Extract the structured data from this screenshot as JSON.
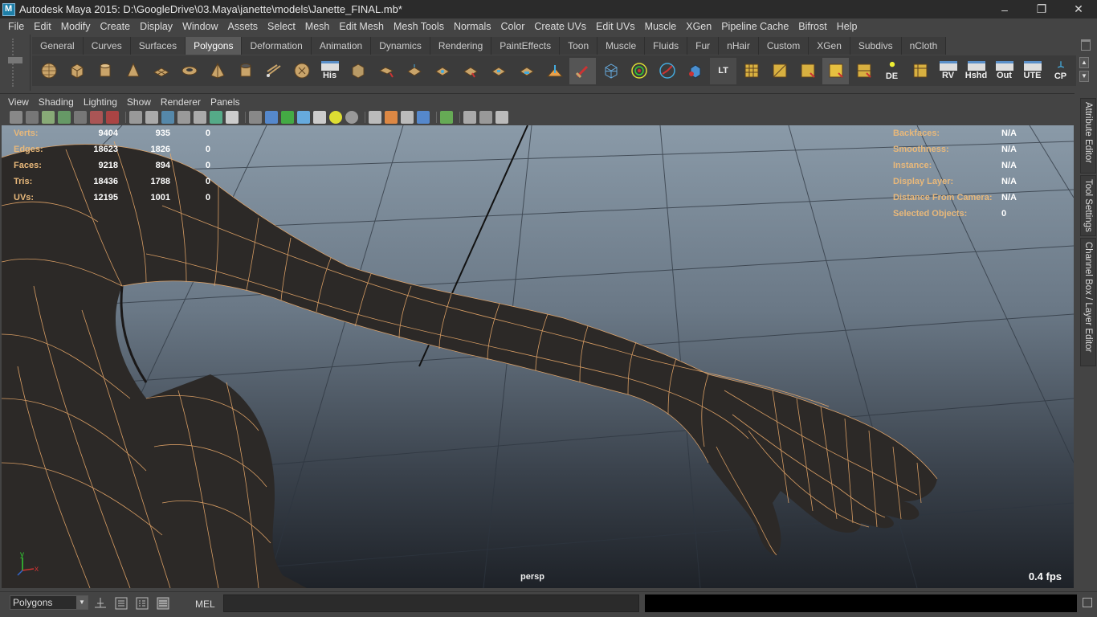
{
  "window": {
    "title": "Autodesk Maya 2015: D:\\GoogleDrive\\03.Maya\\janette\\models\\Janette_FINAL.mb*",
    "minimize": "–",
    "restore": "❐",
    "close": "✕"
  },
  "menubar": [
    "File",
    "Edit",
    "Modify",
    "Create",
    "Display",
    "Window",
    "Assets",
    "Select",
    "Mesh",
    "Edit Mesh",
    "Mesh Tools",
    "Normals",
    "Color",
    "Create UVs",
    "Edit UVs",
    "Muscle",
    "XGen",
    "Pipeline Cache",
    "Bifrost",
    "Help"
  ],
  "shelf": {
    "tabs": [
      "General",
      "Curves",
      "Surfaces",
      "Polygons",
      "Deformation",
      "Animation",
      "Dynamics",
      "Rendering",
      "PaintEffects",
      "Toon",
      "Muscle",
      "Fluids",
      "Fur",
      "nHair",
      "Custom",
      "XGen",
      "Subdivs",
      "nCloth"
    ],
    "active_tab": "Polygons",
    "icon_labels": {
      "his": "His",
      "lt": "LT",
      "de": "DE",
      "rv": "RV",
      "hshd": "Hshd",
      "out": "Out",
      "ute": "UTE",
      "cp": "CP"
    }
  },
  "panel": {
    "menus": [
      "View",
      "Shading",
      "Lighting",
      "Show",
      "Renderer",
      "Panels"
    ],
    "camera": "persp",
    "fps": "0.4 fps"
  },
  "hud": {
    "stats": [
      {
        "label": "Verts:",
        "v1": "9404",
        "v2": "935",
        "v3": "0"
      },
      {
        "label": "Edges:",
        "v1": "18623",
        "v2": "1826",
        "v3": "0"
      },
      {
        "label": "Faces:",
        "v1": "9218",
        "v2": "894",
        "v3": "0"
      },
      {
        "label": "Tris:",
        "v1": "18436",
        "v2": "1788",
        "v3": "0"
      },
      {
        "label": "UVs:",
        "v1": "12195",
        "v2": "1001",
        "v3": "0"
      }
    ],
    "info": [
      {
        "label": "Backfaces:",
        "value": "N/A"
      },
      {
        "label": "Smoothness:",
        "value": "N/A"
      },
      {
        "label": "Instance:",
        "value": "N/A"
      },
      {
        "label": "Display Layer:",
        "value": "N/A"
      },
      {
        "label": "Distance From Camera:",
        "value": "N/A"
      },
      {
        "label": "Selected Objects:",
        "value": "0"
      }
    ],
    "axis_y": "y",
    "axis_x": "x"
  },
  "side_tabs": [
    "Attribute Editor",
    "Tool Settings",
    "Channel Box / Layer Editor"
  ],
  "bottom": {
    "mode": "Polygons",
    "mel_label": "MEL"
  },
  "colors": {
    "wireframe": "#e9a96a",
    "hud_label": "#e8b87a",
    "active_tab": "#5a5a5a"
  }
}
